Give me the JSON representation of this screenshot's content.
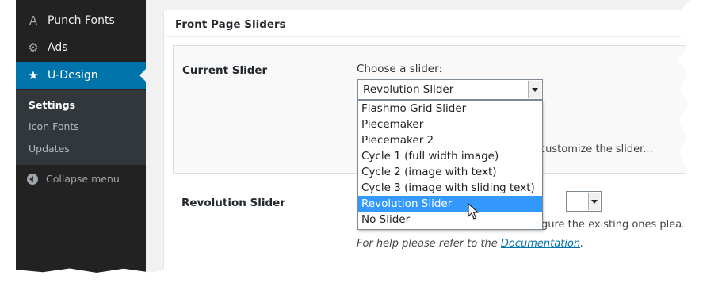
{
  "sidebar": {
    "items": [
      {
        "label": "Punch Fonts",
        "icon": "punch-fonts-icon"
      },
      {
        "label": "Ads",
        "icon": "gear-icon"
      },
      {
        "label": "U-Design",
        "icon": "star-icon"
      }
    ],
    "submenu": [
      "Settings",
      "Icon Fonts",
      "Updates"
    ],
    "collapse_label": "Collapse menu"
  },
  "panel": {
    "title": "Front Page Sliders",
    "current_slider_label": "Current Slider",
    "choose_label": "Choose a slider:",
    "selected_value": "Revolution Slider",
    "customize_text": "customize the slider...",
    "revolution_label": "Revolution Slider",
    "configure_text": "gure the existing ones please r",
    "help_prefix": "For help please refer to the ",
    "help_link": "Documentation",
    "help_suffix": "."
  },
  "dropdown": {
    "options": [
      "Flashmo Grid Slider",
      "Piecemaker",
      "Piecemaker 2",
      "Cycle 1 (full width image)",
      "Cycle 2 (image with text)",
      "Cycle 3 (image with sliding text)",
      "Revolution Slider",
      "No Slider"
    ],
    "highlighted_index": 6
  },
  "colors": {
    "sidebar_bg": "#222222",
    "submenu_bg": "#32373c",
    "active_bg": "#0073aa",
    "highlight": "#3399ff",
    "link": "#0073aa"
  }
}
